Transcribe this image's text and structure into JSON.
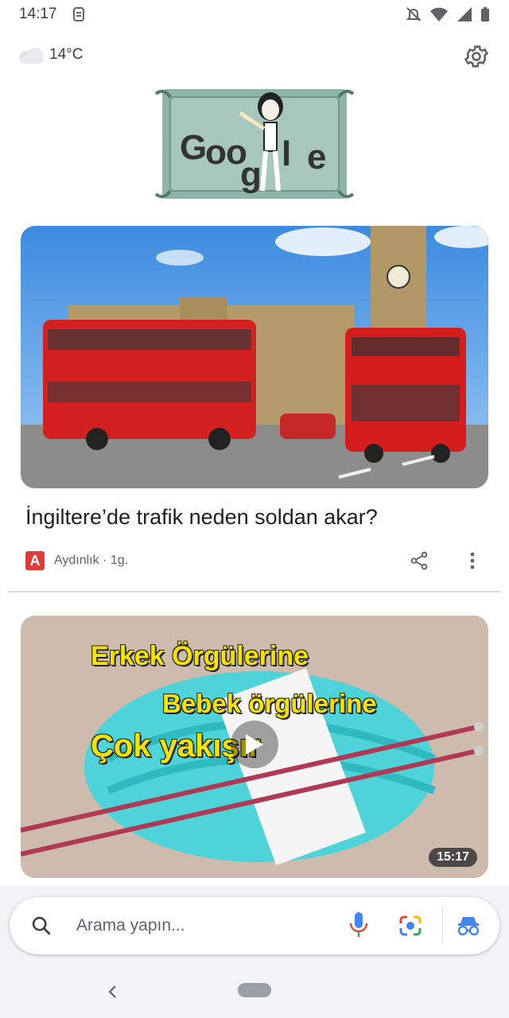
{
  "status_bar": {
    "time": "14:17"
  },
  "weather": {
    "temperature": "14°C",
    "icon": "cloud-icon"
  },
  "doodle": {
    "letters": [
      "G",
      "o",
      "o",
      "g",
      "l",
      "e"
    ]
  },
  "article": {
    "headline": "İngiltere’de trafik neden soldan akar?",
    "source": "Aydınlık · 1g.",
    "source_logo_letter": "A"
  },
  "video": {
    "overlay_line1": "Erkek Örgülerine",
    "overlay_line2": "Bebek örgülerine",
    "overlay_line3": "Çok yakışır",
    "duration": "15:17"
  },
  "search": {
    "placeholder": "Arama yapın..."
  },
  "colors": {
    "accent_blue": "#4285f4",
    "source_red": "#e53935"
  }
}
